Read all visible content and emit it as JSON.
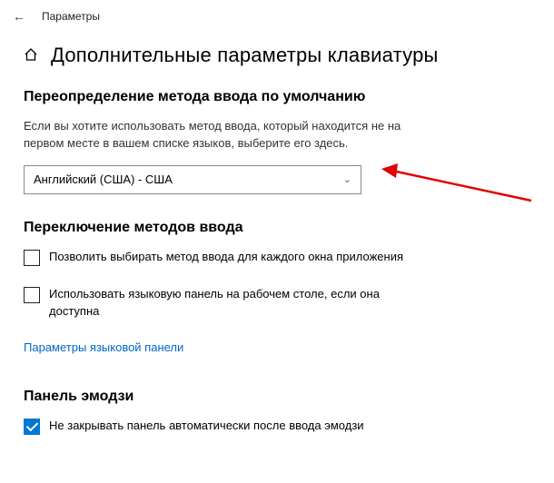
{
  "titlebar": {
    "label": "Параметры"
  },
  "page": {
    "title": "Дополнительные параметры клавиатуры"
  },
  "section_default_method": {
    "title": "Переопределение метода ввода по умолчанию",
    "description": "Если вы хотите использовать метод ввода, который находится не на первом месте в вашем списке языков, выберите его здесь.",
    "dropdown_value": "Английский (США) - США"
  },
  "section_switching": {
    "title": "Переключение методов ввода",
    "checkbox1_label": "Позволить выбирать метод ввода для каждого окна приложения",
    "checkbox2_label": "Использовать языковую панель на рабочем столе, если она доступна",
    "link_label": "Параметры языковой панели"
  },
  "section_emoji": {
    "title": "Панель эмодзи",
    "checkbox_label": "Не закрывать панель автоматически после ввода эмодзи"
  }
}
